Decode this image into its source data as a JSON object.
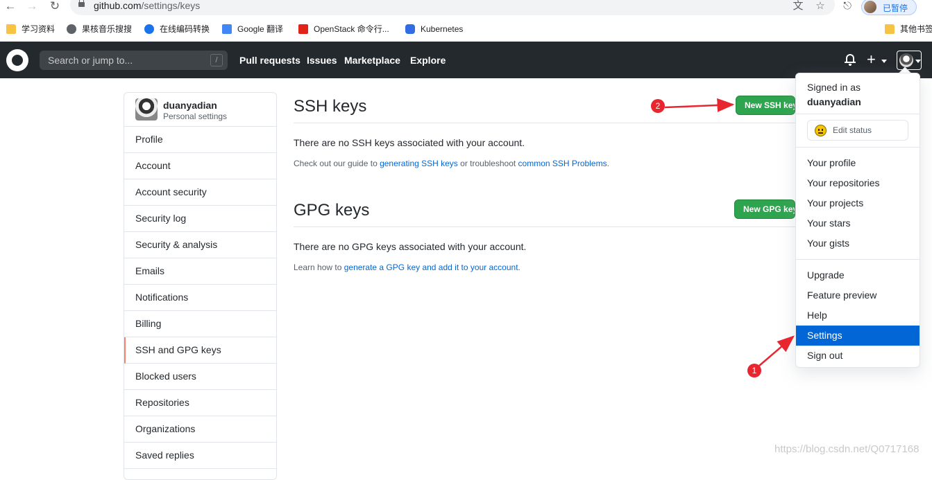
{
  "browser": {
    "url_host": "github.com",
    "url_path": "/settings/keys",
    "profile_label": "已暂停",
    "bookmarks": [
      {
        "label": "学习资料",
        "icon": "folder-icon"
      },
      {
        "label": "果核音乐搜搜",
        "icon": "globe-icon"
      },
      {
        "label": "在线编码转换",
        "icon": "site-icon"
      },
      {
        "label": "Google 翻译",
        "icon": "translate-icon"
      },
      {
        "label": "OpenStack 命令行...",
        "icon": "openstack-icon"
      },
      {
        "label": "Kubernetes",
        "icon": "kubernetes-icon"
      },
      {
        "label": "其他书签",
        "icon": "folder-icon"
      }
    ]
  },
  "header": {
    "search_placeholder": "Search or jump to...",
    "search_key": "/",
    "nav": [
      "Pull requests",
      "Issues",
      "Marketplace",
      "Explore"
    ],
    "plus": "+"
  },
  "sidebar": {
    "username": "duanyadian",
    "subtitle": "Personal settings",
    "items": [
      "Profile",
      "Account",
      "Account security",
      "Security log",
      "Security & analysis",
      "Emails",
      "Notifications",
      "Billing",
      "SSH and GPG keys",
      "Blocked users",
      "Repositories",
      "Organizations",
      "Saved replies"
    ],
    "selected": "SSH and GPG keys"
  },
  "ssh": {
    "title": "SSH keys",
    "button": "New SSH key",
    "empty": "There are no SSH keys associated with your account.",
    "note_pre": "Check out our guide to ",
    "link1": "generating SSH keys",
    "note_mid": " or troubleshoot ",
    "link2": "common SSH Problems",
    "note_end": "."
  },
  "gpg": {
    "title": "GPG keys",
    "button": "New GPG key",
    "empty": "There are no GPG keys associated with your account.",
    "note_pre": "Learn how to ",
    "link": "generate a GPG key and add it to your account",
    "note_end": "."
  },
  "dropdown": {
    "signed_in_as": "Signed in as",
    "username": "duanyadian",
    "edit_status": "Edit status",
    "group1": [
      "Your profile",
      "Your repositories",
      "Your projects",
      "Your stars",
      "Your gists"
    ],
    "group2": [
      "Upgrade",
      "Feature preview",
      "Help",
      "Settings",
      "Sign out"
    ],
    "highlighted": "Settings"
  },
  "annotations": {
    "badge1": "1",
    "badge2": "2",
    "color": "#e8262f"
  },
  "watermark": "https://blog.csdn.net/Q0717168",
  "colors": {
    "header_bg": "#24292e",
    "green_button": "#2ea44f",
    "link": "#0366d6",
    "selected_indicator": "#f9826c"
  }
}
